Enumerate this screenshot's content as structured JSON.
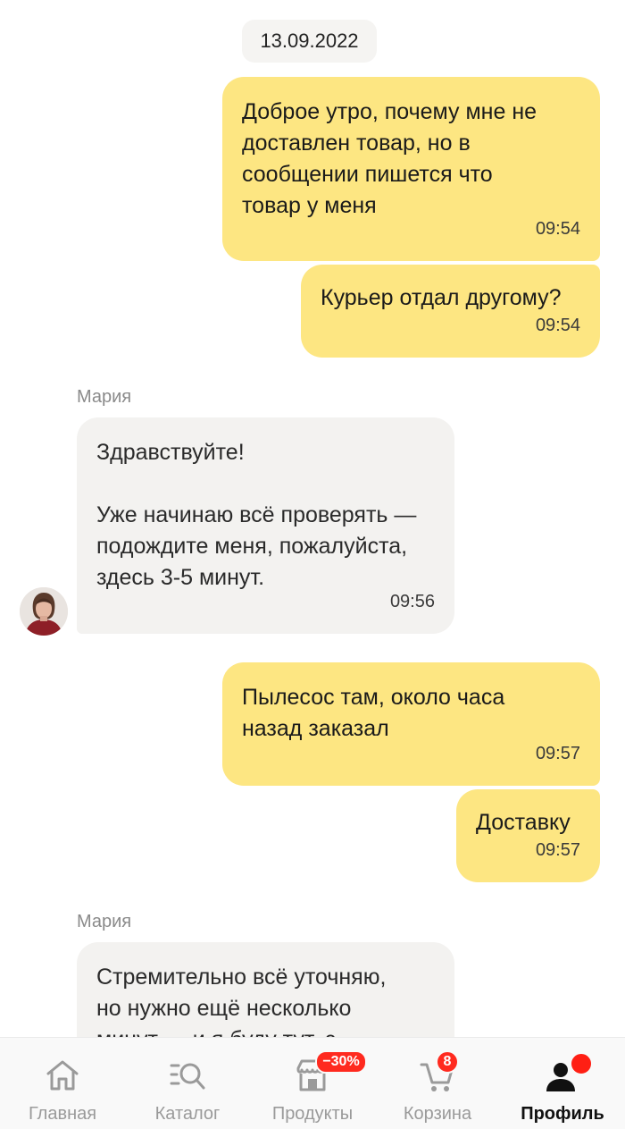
{
  "chat": {
    "date": "13.09.2022",
    "messages": [
      {
        "text": "Доброе утро, почему мне не\nдоставлен товар, но в\nсообщении пишется что\nтовар у меня",
        "time": "09:54"
      },
      {
        "text": "Курьер отдал другому?",
        "time": "09:54"
      },
      {
        "sender": "Мария",
        "text": "Здравствуйте!\n\nУже начинаю всё проверять —\nподождите меня, пожалуйста,\nздесь 3-5 минут.",
        "time": "09:56"
      },
      {
        "text": "Пылесос там, около часа\nназад заказал",
        "time": "09:57"
      },
      {
        "text": "Доставку",
        "time": "09:57"
      },
      {
        "sender": "Мария",
        "text": "Стремительно всё уточняю,\nно нужно ещё несколько\nминут — и я буду тут, с"
      }
    ]
  },
  "tabbar": {
    "items": [
      {
        "label": "Главная",
        "icon": "home-icon"
      },
      {
        "label": "Каталог",
        "icon": "catalog-search-icon"
      },
      {
        "label": "Продукты",
        "icon": "store-icon",
        "badge": "−30%"
      },
      {
        "label": "Корзина",
        "icon": "cart-icon",
        "badge": "8"
      },
      {
        "label": "Профиль",
        "icon": "profile-icon",
        "active": true
      }
    ]
  },
  "colors": {
    "outgoing_bubble": "#fde682",
    "incoming_bubble": "#f3f2f0",
    "badge": "#ff2a1f"
  }
}
